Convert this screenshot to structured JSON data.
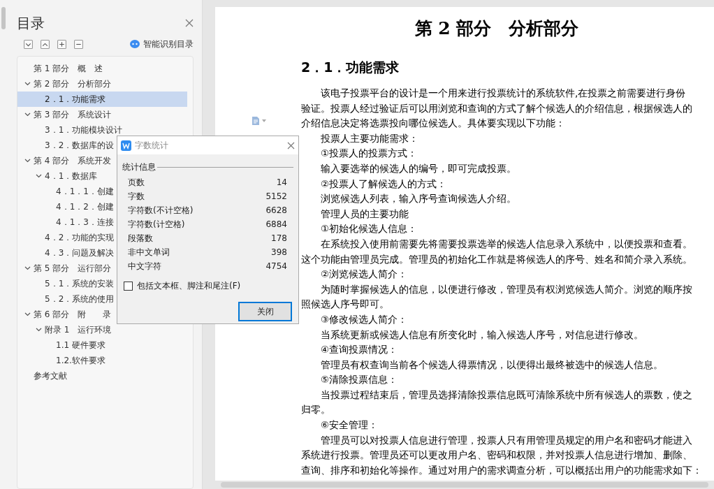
{
  "toc_panel": {
    "title": "目录",
    "smart_toc": "智能识别目录",
    "items": [
      {
        "label": "第 1 部分　概　述",
        "selected": false
      },
      {
        "label": "第 2 部分　分析部分",
        "selected": false,
        "expanded": true,
        "children": [
          {
            "label": "2．1．功能需求",
            "selected": true
          }
        ]
      },
      {
        "label": "第 3 部分　系统设计",
        "selected": false,
        "expanded": true,
        "children": [
          {
            "label": "3．1．功能模块设计",
            "selected": false
          },
          {
            "label": "3．2．数据库的设",
            "selected": false
          }
        ]
      },
      {
        "label": "第 4 部分　系统开发",
        "selected": false,
        "expanded": true,
        "children": [
          {
            "label": "4．1．数据库",
            "selected": false,
            "expanded": true,
            "children": [
              {
                "label": "4．1．1．创建",
                "selected": false
              },
              {
                "label": "4．1．2．创建",
                "selected": false
              },
              {
                "label": "4．1．3．连接",
                "selected": false
              }
            ]
          },
          {
            "label": "4．2．功能的实现",
            "selected": false
          },
          {
            "label": "4．3．问题及解决",
            "selected": false
          }
        ]
      },
      {
        "label": "第 5 部分　运行部分",
        "selected": false,
        "expanded": true,
        "children": [
          {
            "label": "5．1．系统的安装",
            "selected": false
          },
          {
            "label": "5．2．系统的使用",
            "selected": false
          }
        ]
      },
      {
        "label": "第 6 部分　附　　录",
        "selected": false,
        "expanded": true,
        "children": [
          {
            "label": "附录 1　运行环境",
            "selected": false,
            "expanded": true,
            "children": [
              {
                "label": "1.1 硬件要求",
                "selected": false
              },
              {
                "label": "1.2.软件要求",
                "selected": false
              }
            ]
          }
        ]
      },
      {
        "label": "参考文献",
        "selected": false
      }
    ]
  },
  "document": {
    "title": "第 2 部分　分析部分",
    "heading": "2．1．功能需求",
    "paragraphs": [
      {
        "lines": [
          "该电子投票平台的设计是一个用来进行投票统计的系统软件,在投票之前需要进行身份",
          "验证。投票人经过验证后可以用浏览和查询的方式了解个候选人的介绍信息，根据候选人的",
          "介绍信息决定将选票投向哪位候选人。具体要实现以下功能："
        ]
      },
      {
        "lines": [
          "投票人主要功能需求："
        ]
      },
      {
        "lines": [
          "①投票人的投票方式："
        ]
      },
      {
        "lines": [
          "输入要选举的候选人的编号，即可完成投票。"
        ]
      },
      {
        "lines": [
          "②投票人了解候选人的方式："
        ]
      },
      {
        "lines": [
          "浏览候选人列表，输入序号查询候选人介绍。"
        ]
      },
      {
        "lines": [
          "管理人员的主要功能"
        ]
      },
      {
        "lines": [
          "①初始化候选人信息："
        ]
      },
      {
        "lines": [
          "在系统投入使用前需要先将需要投票选举的候选人信息录入系统中，以便投票和查看。",
          "这个功能由管理员完成。管理员的初始化工作就是将候选人的序号、姓名和简介录入系统。"
        ]
      },
      {
        "lines": [
          "②浏览候选人简介："
        ]
      },
      {
        "lines": [
          "为随时掌握候选人的信息，以便进行修改，管理员有权浏览候选人简介。浏览的顺序按",
          "照候选人序号即可。"
        ]
      },
      {
        "lines": [
          "③修改候选人简介："
        ]
      },
      {
        "lines": [
          "当系统更新或候选人信息有所变化时，输入候选人序号，对信息进行修改。"
        ]
      },
      {
        "lines": [
          "④查询投票情况："
        ]
      },
      {
        "lines": [
          "管理员有权查询当前各个候选人得票情况，以便得出最终被选中的候选人信息。"
        ]
      },
      {
        "lines": [
          "⑤清除投票信息："
        ]
      },
      {
        "lines": [
          "当投票过程结束后，管理员选择清除投票信息既可清除系统中所有候选人的票数，使之",
          "归零。"
        ]
      },
      {
        "lines": [
          "⑥安全管理："
        ]
      },
      {
        "lines": [
          "管理员可以对投票人信息进行管理，投票人只有用管理员规定的用户名和密码才能进入",
          "系统进行投票。管理员还可以更改用户名、密码和权限，并对投票人信息进行增加、删除、",
          "查询、排序和初始化等操作。通过对用户的需求调查分析，可以概括出用户的功能需求如下："
        ]
      }
    ]
  },
  "word_count_dialog": {
    "title": "字数统计",
    "group": "统计信息",
    "stats": [
      {
        "label": "页数",
        "value": "14"
      },
      {
        "label": "字数",
        "value": "5152"
      },
      {
        "label": "字符数(不计空格)",
        "value": "6628"
      },
      {
        "label": "字符数(计空格)",
        "value": "6884"
      },
      {
        "label": "段落数",
        "value": "178"
      },
      {
        "label": "非中文单词",
        "value": "398"
      },
      {
        "label": "中文字符",
        "value": "4754"
      }
    ],
    "include_option": {
      "label": "包括文本框、脚注和尾注(F)",
      "checked": false
    },
    "close_button": "关闭"
  }
}
